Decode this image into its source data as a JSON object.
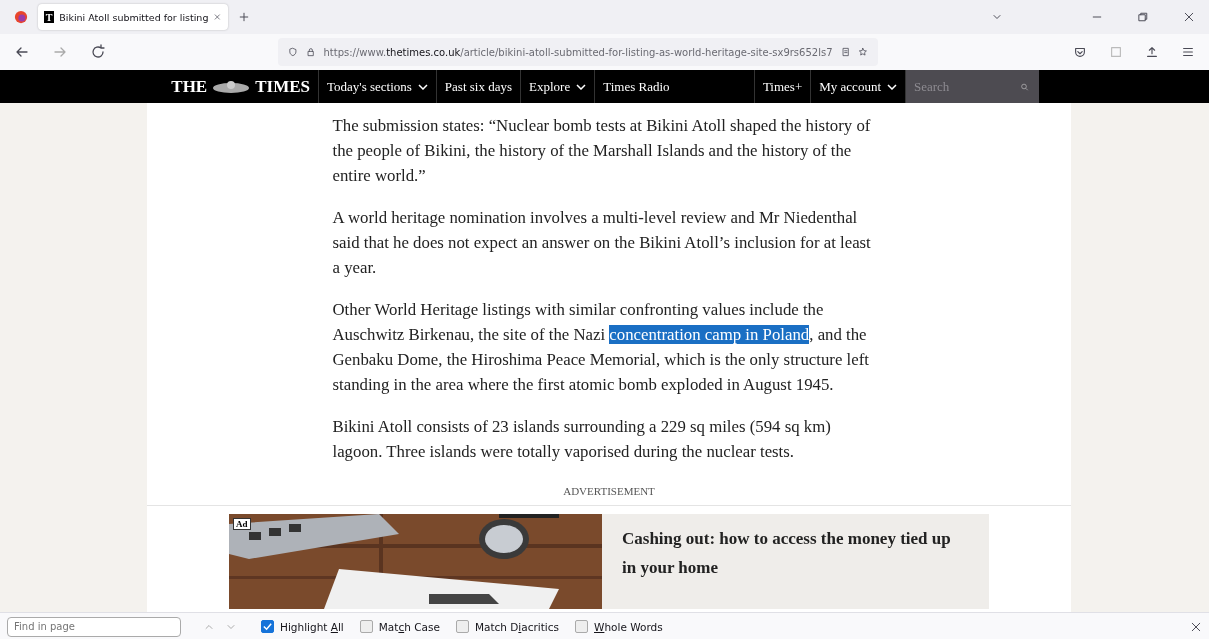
{
  "tab": {
    "favicon_letter": "T",
    "title": "Bikini Atoll submitted for listing",
    "selected": true
  },
  "address_bar": {
    "url_prefix": "https://www.",
    "url_domain": "thetimes.co.uk",
    "url_path": "/article/bikini-atoll-submitted-for-listing-as-world-heritage-site-sx9rs652ls7"
  },
  "site_nav": {
    "logo_left": "THE",
    "logo_right": "TIMES",
    "items": [
      {
        "label": "Today's sections",
        "dropdown": true
      },
      {
        "label": "Past six days",
        "dropdown": false
      },
      {
        "label": "Explore",
        "dropdown": true
      },
      {
        "label": "Times Radio",
        "dropdown": false
      }
    ],
    "right_items": [
      {
        "label": "Times+",
        "dropdown": false
      },
      {
        "label": "My account",
        "dropdown": true
      }
    ],
    "search": {
      "placeholder": "Search"
    }
  },
  "article": {
    "paragraphs": [
      {
        "before": "The submission states: “Nuclear bomb tests at Bikini Atoll shaped the history of the people of Bikini, the history of the Marshall Islands and the history of the entire world.”"
      },
      {
        "before": "A world heritage nomination involves a multi-level review and Mr Niedenthal said that he does not expect an answer on the Bikini Atoll’s inclusion for at least a year."
      },
      {
        "before": "Other World Heritage listings with similar confronting values include the Auschwitz Birkenau, the site of the Nazi ",
        "match": "concentration camp in Poland",
        "after": ", and the Genbaku Dome, the Hiroshima Peace Memorial, which is the only structure left standing in the area where the first atomic bomb exploded in August 1945."
      },
      {
        "before": "Bikini Atoll consists of 23 islands surrounding a 229 sq miles (594 sq km) lagoon. Three islands were totally vaporised during the nuclear tests."
      }
    ],
    "ad_label": "ADVERTISEMENT",
    "ad": {
      "badge": "Ad",
      "headline": "Cashing out: how to access the money tied up in your home"
    }
  },
  "find_bar": {
    "placeholder": "Find in page",
    "options": [
      {
        "pre": "Highlight ",
        "key": "A",
        "post": "ll",
        "checked": true
      },
      {
        "pre": "Mat",
        "key": "c",
        "post": "h Case",
        "checked": false
      },
      {
        "pre": "Match D",
        "key": "i",
        "post": "acritics",
        "checked": false
      },
      {
        "key": "W",
        "post": "hole Words",
        "checked": false
      }
    ]
  }
}
